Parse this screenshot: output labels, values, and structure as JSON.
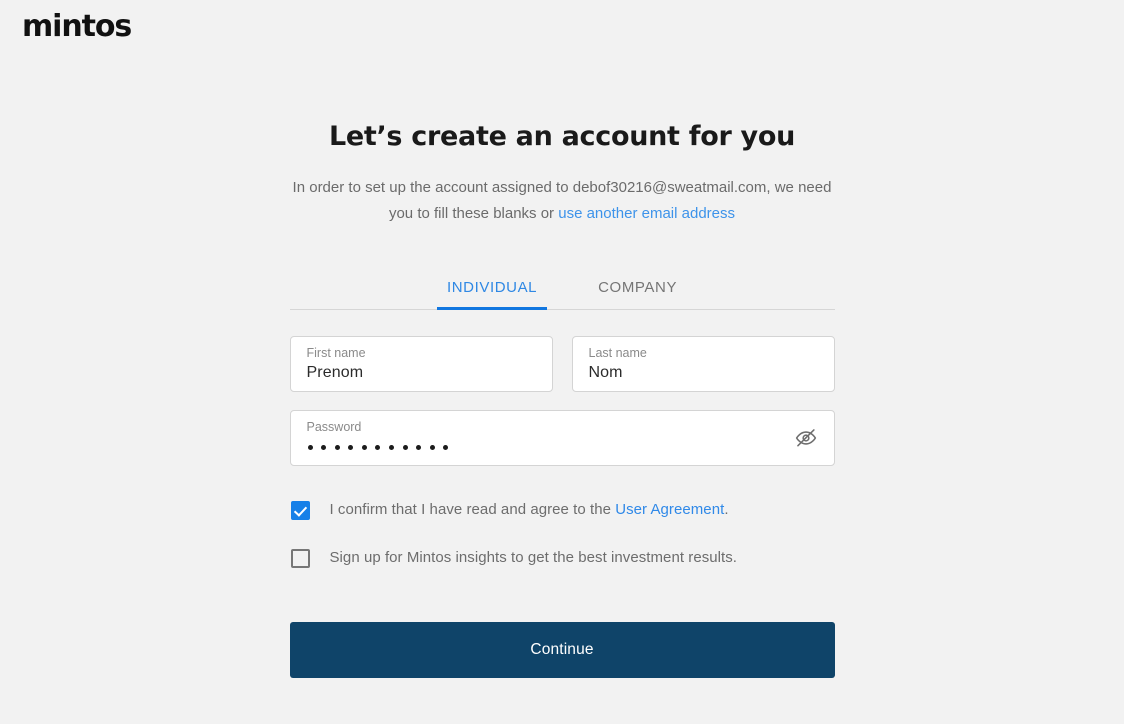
{
  "brand": {
    "logo_text": "mintos"
  },
  "page": {
    "title": "Let’s create an account for you",
    "subtitle_part1": "In order to set up the account assigned to debof30216@sweatmail.com, we need you to fill these blanks or ",
    "subtitle_link": "use another email address",
    "email": "debof30216@sweatmail.com"
  },
  "tabs": [
    {
      "label": "INDIVIDUAL",
      "active": true
    },
    {
      "label": "COMPANY",
      "active": false
    }
  ],
  "form": {
    "first_name": {
      "label": "First name",
      "value": "Prenom",
      "placeholder": "First name"
    },
    "last_name": {
      "label": "Last name",
      "value": "Nom",
      "placeholder": "Last name"
    },
    "password": {
      "label": "Password",
      "value": "•••••••••••",
      "placeholder": "Password",
      "masked_length": 11,
      "toggle_icon": "eye-off-icon"
    }
  },
  "consents": [
    {
      "checked": true,
      "text_before": "I confirm that I have read and agree to the ",
      "link": "User Agreement",
      "text_after": "."
    },
    {
      "checked": false,
      "text_before": "Sign up for Mintos insights to get the best investment results.",
      "link": "",
      "text_after": ""
    }
  ],
  "actions": {
    "continue_label": "Continue"
  },
  "colors": {
    "background": "#f2f2f2",
    "accent_blue": "#1680e8",
    "link_blue": "#3089e8",
    "button_navy": "#0f4469",
    "text_dark": "#1a1a1a",
    "text_muted": "#6b6b6b",
    "border_gray": "#d4d4d4"
  }
}
